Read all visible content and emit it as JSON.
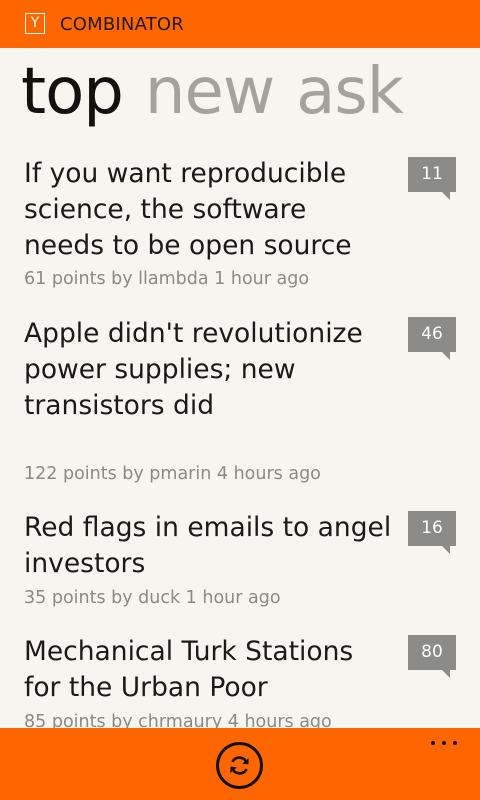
{
  "header": {
    "logo_letter": "Y",
    "title": "COMBINATOR"
  },
  "pivot": {
    "items": [
      "top",
      "new",
      "ask"
    ],
    "active": "top"
  },
  "stories": [
    {
      "title": "If you want reproducible science, the software needs to be open source",
      "meta": "61 points by llambda 1 hour ago",
      "comments": "11"
    },
    {
      "title": "Apple didn't revolutionize power supplies; new transistors did",
      "meta": "122 points by pmarin 4 hours ago",
      "comments": "46"
    },
    {
      "title": "Red flags in emails to angel investors",
      "meta": "35 points by duck 1 hour ago",
      "comments": "16"
    },
    {
      "title": "Mechanical Turk Stations for the Urban Poor",
      "meta": "85 points by chrmaury 4 hours ago",
      "comments": "80"
    }
  ],
  "appbar": {
    "refresh_icon": "refresh-icon",
    "more_icon": "ellipsis-icon"
  },
  "colors": {
    "accent": "#ff6600",
    "background": "#f6f5ef",
    "badge": "#8b8b88"
  }
}
